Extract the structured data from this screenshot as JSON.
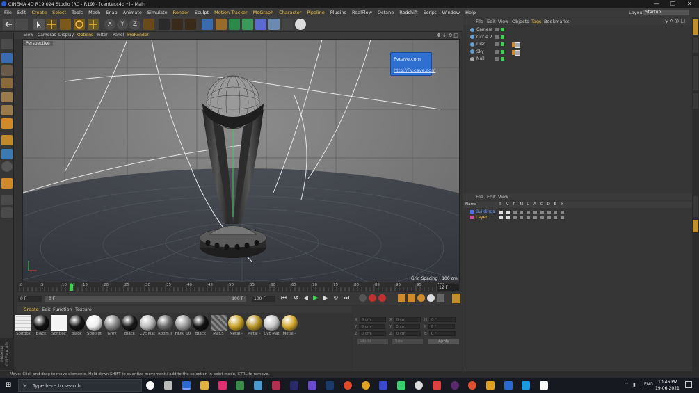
{
  "window": {
    "title": "CINEMA 4D R19.024 Studio (RC - R19) - [center.c4d *] - Main",
    "layout_label": "Layout:",
    "layout_value": "Startup"
  },
  "menu": [
    "File",
    "Edit",
    "Create",
    "Select",
    "Tools",
    "Mesh",
    "Snap",
    "Animate",
    "Simulate",
    "Render",
    "Sculpt",
    "Motion Tracker",
    "MoGraph",
    "Character",
    "Pipeline",
    "Plugins",
    "RealFlow",
    "Octane",
    "Redshift",
    "Script",
    "Window",
    "Help"
  ],
  "viewport": {
    "menu": [
      "View",
      "Cameras",
      "Display",
      "Options",
      "Filter",
      "Panel",
      "ProRender"
    ],
    "label": "Perspective",
    "grid_spacing": "Grid Spacing : 100 cm",
    "tooltip_title": "Fvcave.com",
    "tooltip_link": "http://Fv.cave.com"
  },
  "timeline": {
    "ticks": [
      "0",
      "5",
      "10",
      "12",
      "15",
      "20",
      "25",
      "30",
      "35",
      "40",
      "45",
      "50",
      "55",
      "60",
      "65",
      "70",
      "75",
      "80",
      "85",
      "90",
      "95",
      "100"
    ],
    "current_frame": "12 F",
    "start": "0 F",
    "min": "0 F",
    "max": "100 F",
    "end": "100 F"
  },
  "materials": {
    "menu": [
      "Create",
      "Edit",
      "Function",
      "Texture"
    ],
    "items": [
      {
        "label": "Softbox",
        "color": "#e8e8e8",
        "kind": "grid"
      },
      {
        "label": "Black",
        "color": "#111111"
      },
      {
        "label": "Softbox",
        "color": "#f4f4f4",
        "kind": "flat"
      },
      {
        "label": "Black",
        "color": "#151515"
      },
      {
        "label": "Spotligt",
        "color": "#f0f0f0"
      },
      {
        "label": "Grey",
        "color": "#888888"
      },
      {
        "label": "Black",
        "color": "#1a1a1a"
      },
      {
        "label": "Cyc Mat",
        "color": "#bdbdbd"
      },
      {
        "label": "Room T",
        "color": "#6a6a6a"
      },
      {
        "label": "HDRI 00",
        "color": "#9a9a9a"
      },
      {
        "label": "Black",
        "color": "#121212"
      },
      {
        "label": "Mat.5",
        "color": "#777777",
        "kind": "stripe"
      },
      {
        "label": "Metal -",
        "color": "#c9a227"
      },
      {
        "label": "Metal -",
        "color": "#b8952a"
      },
      {
        "label": "Cyc Mat",
        "color": "#c8c8c8"
      },
      {
        "label": "Metal -",
        "color": "#d4aa30"
      }
    ]
  },
  "attributes": {
    "labels": [
      "X",
      "Y",
      "Z"
    ],
    "value": "0 cm",
    "labels2": [
      "X",
      "Y",
      "Z"
    ],
    "labels3": [
      "H",
      "P",
      "B"
    ],
    "value3": "0 °",
    "dropdown1": "World",
    "dropdown2": "Size",
    "apply": "Apply"
  },
  "objects": {
    "menu": [
      "File",
      "Edit",
      "View",
      "Objects",
      "Tags",
      "Bookmarks"
    ],
    "items": [
      "Camera",
      "Circle.2",
      "Disc",
      "Sky",
      "Null"
    ]
  },
  "layers": {
    "menu": [
      "File",
      "Edit",
      "View"
    ],
    "header": [
      "Name",
      "S",
      "V",
      "R",
      "M",
      "L",
      "A",
      "G",
      "D",
      "E",
      "X"
    ],
    "items": [
      {
        "name": "Buildings",
        "color": "#4a6cff"
      },
      {
        "name": "Layer",
        "color": "#e040a0"
      }
    ]
  },
  "status": "Move: Click and drag to move elements. Hold down SHIFT to quantize movement / add to the selection in point mode, CTRL to remove.",
  "taskbar": {
    "search": "Type here to search",
    "time": "10:46 PM",
    "date": "19-06-2021",
    "lang": "ENG"
  },
  "colors": {
    "accent": "#f0c040",
    "viewport_bg": "#7b7b7b",
    "floor": "#3a3d42"
  }
}
